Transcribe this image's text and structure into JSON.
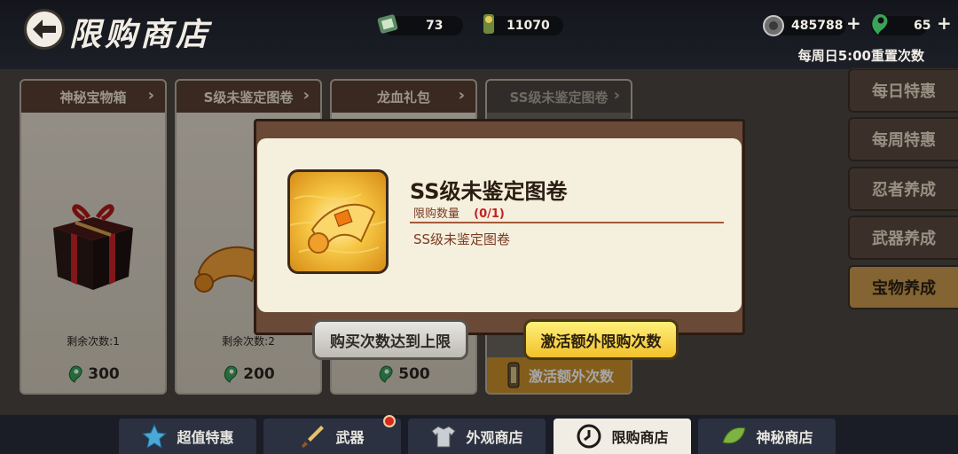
{
  "header": {
    "title": "限购商店",
    "resources": [
      {
        "name": "scroll-ticket",
        "value": "73"
      },
      {
        "name": "ninja-coin",
        "value": "11070"
      },
      {
        "name": "silver-coin",
        "value": "485788"
      },
      {
        "name": "gem-magatama",
        "value": "65"
      }
    ],
    "reset_note": "每周日5:00重置次数",
    "colors": {
      "magatama": "#3aa35a",
      "gold": "#f2c12b",
      "active_tab": "#c99a4d"
    }
  },
  "cards": [
    {
      "title": "神秘宝物箱",
      "remaining": "剩余次数:1",
      "price": "300",
      "icon": "gift-box-icon"
    },
    {
      "title": "S级未鉴定图卷",
      "remaining": "剩余次数:2",
      "price": "200",
      "icon": "scroll-icon"
    },
    {
      "title": "龙血礼包",
      "remaining": "",
      "price": "500",
      "icon": "gift-icon"
    },
    {
      "title": "SS级未鉴定图卷",
      "activate_label": "激活额外次数",
      "icon": "scroll-icon"
    }
  ],
  "side_tabs": [
    "每日特惠",
    "每周特惠",
    "忍者养成",
    "武器养成",
    "宝物养成"
  ],
  "popup": {
    "title": "SS级未鉴定图卷",
    "limit_label": "限购数量",
    "limit_value": "(0/1)",
    "description": "SS级未鉴定图卷",
    "disabled_button": "购买次数达到上限",
    "activate_button": "激活额外限购次数"
  },
  "bottom_nav": [
    {
      "label": "超值特惠",
      "icon": "star-icon"
    },
    {
      "label": "武器",
      "icon": "sword-icon",
      "badge": true
    },
    {
      "label": "外观商店",
      "icon": "shirt-icon"
    },
    {
      "label": "限购商店",
      "icon": "clock-icon",
      "active": true
    },
    {
      "label": "神秘商店",
      "icon": "leaf-icon"
    }
  ]
}
